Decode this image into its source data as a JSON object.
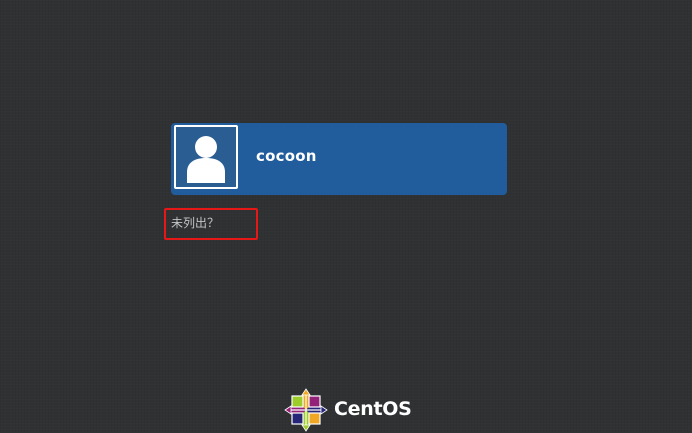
{
  "user_list": {
    "users": [
      {
        "name": "cocoon",
        "avatar_icon": "user-silhouette-icon"
      }
    ]
  },
  "not_listed": {
    "label": "未列出？",
    "highlight_color": "#e51717"
  },
  "branding": {
    "logo_icon": "centos-logo-icon",
    "text": "CentOS"
  },
  "colors": {
    "background": "#2f3133",
    "user_card": "#215d9c",
    "text_primary": "#ffffff",
    "text_secondary": "#c3c5c5"
  }
}
